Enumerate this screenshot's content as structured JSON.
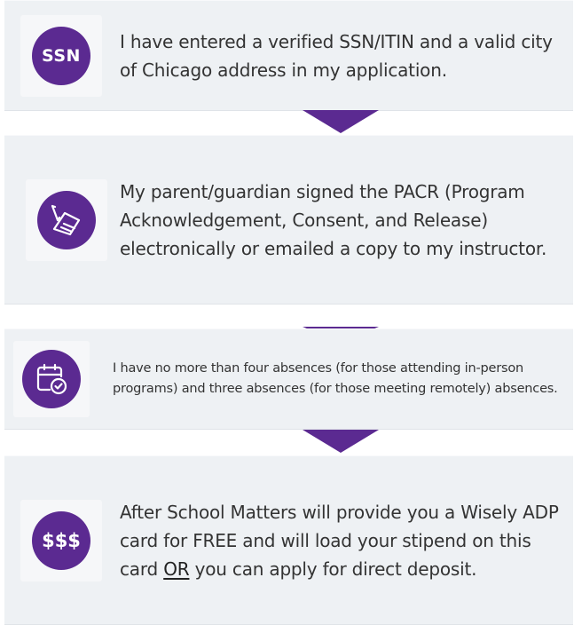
{
  "steps": [
    {
      "icon": "ssn-badge-icon",
      "icon_label": "SSN",
      "text": "I have entered a verified SSN/ITIN and a valid city of Chicago address in my application."
    },
    {
      "icon": "signed-document-icon",
      "text": "My parent/guardian signed the PACR (Program Acknowledgement, Consent, and Release) electronically or emailed a copy to my instructor."
    },
    {
      "icon": "calendar-check-icon",
      "text": "I have no more than four absences (for those attending in-person programs) and three absences (for those meeting remotely) absences."
    },
    {
      "icon": "money-badge-icon",
      "icon_label": "$$$",
      "text_before": "After School Matters will provide you a Wisely ADP card for FREE and will load your stipend on this card ",
      "text_emphasis": "OR",
      "text_after": " you can apply for direct deposit."
    }
  ],
  "colors": {
    "accent": "#5b2a91",
    "panel": "#eef1f4",
    "text": "#333333"
  }
}
